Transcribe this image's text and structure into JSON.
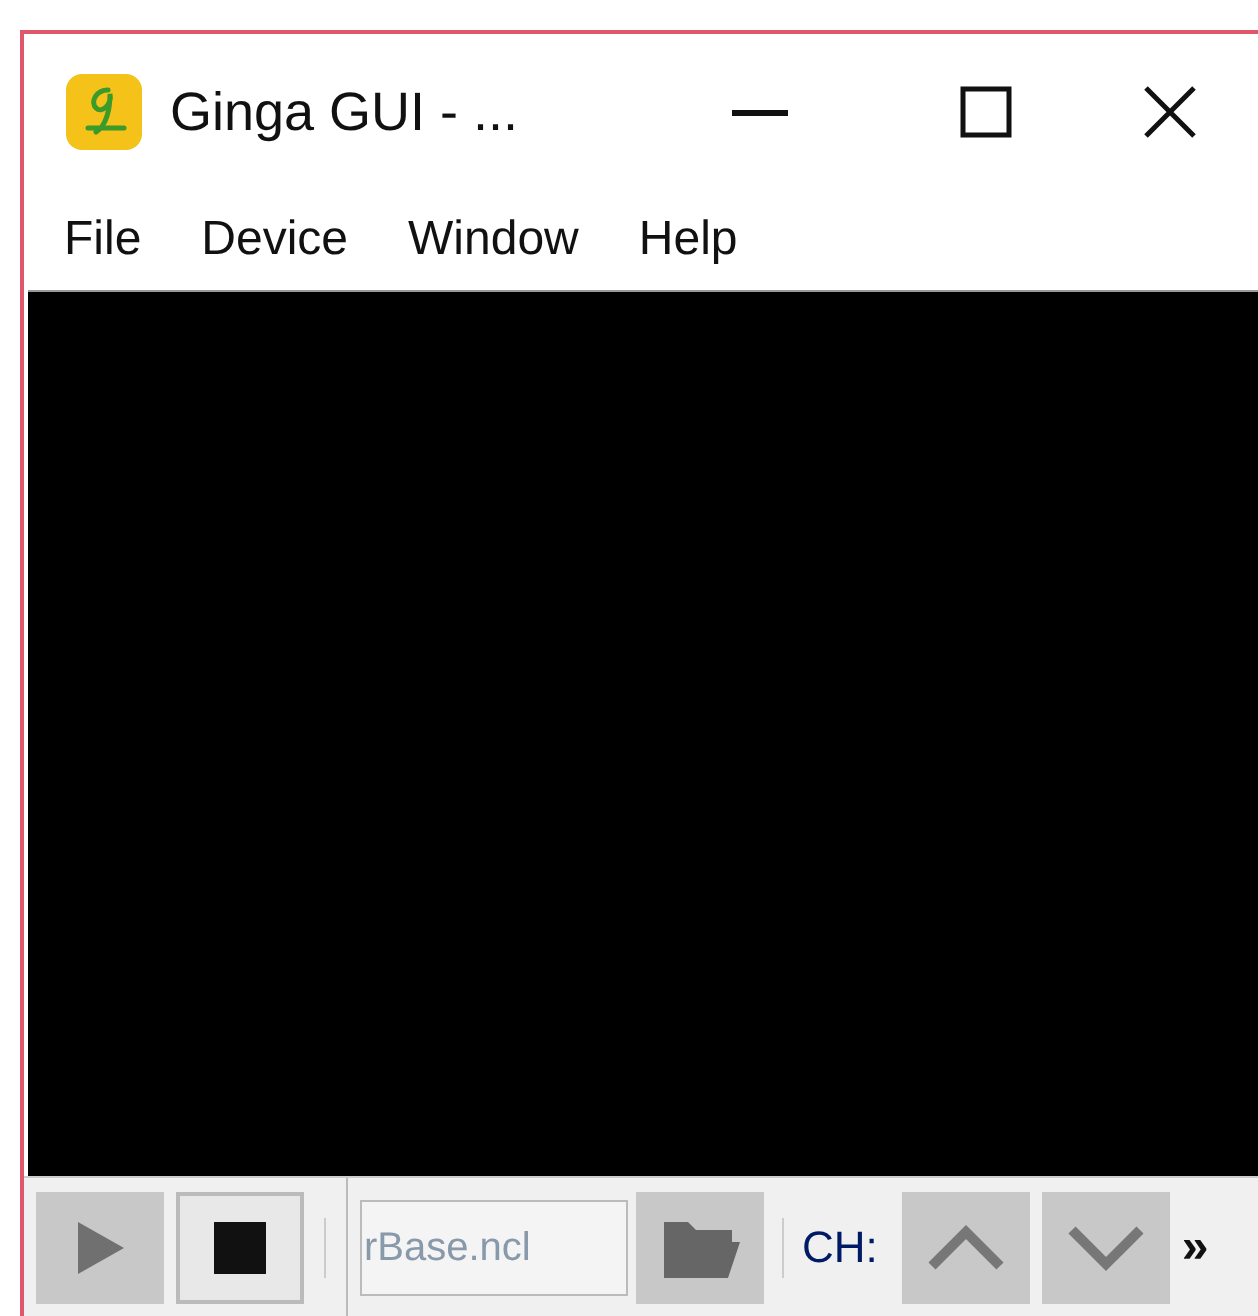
{
  "window": {
    "title": "Ginga GUI - ..."
  },
  "menu": [
    {
      "label": "File"
    },
    {
      "label": "Device"
    },
    {
      "label": "Window"
    },
    {
      "label": "Help"
    }
  ],
  "toolbar": {
    "play": {
      "disabled": true
    },
    "stop": {
      "disabled": false
    },
    "file_field": {
      "value": "rBase.ncl"
    },
    "channel_label": "CH:",
    "channel_up": {
      "disabled": true
    },
    "channel_down": {
      "disabled": true
    },
    "overflow": "»"
  }
}
